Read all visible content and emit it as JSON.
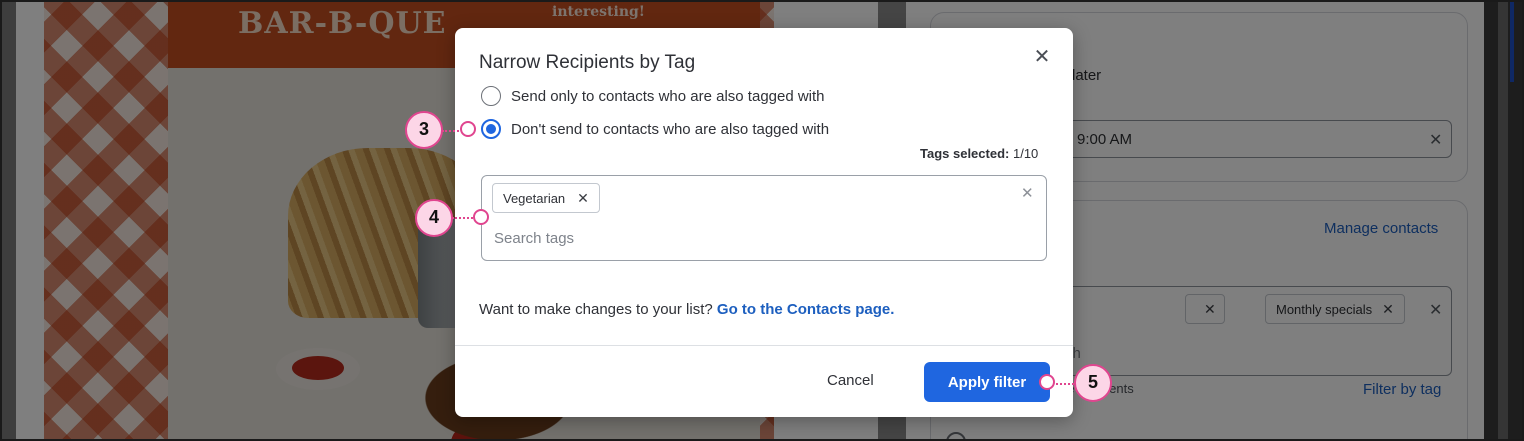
{
  "background": {
    "email": {
      "brand_title": "BAR-B-QUE",
      "header_subtext": "interesting!"
    },
    "settings": {
      "schedule_text": "later",
      "time_value": "9:00 AM",
      "manage_contacts_link": "Manage contacts",
      "chip_partial_label": "",
      "chip_monthly": "Monthly specials",
      "search_partial": "rch",
      "recipients_partial": "ue recipients",
      "filter_by_tag_link": "Filter by tag"
    }
  },
  "modal": {
    "title": "Narrow Recipients by Tag",
    "options": [
      {
        "label": "Send only to contacts who are also tagged with",
        "selected": false
      },
      {
        "label": "Don't send to contacts who are also tagged with",
        "selected": true
      }
    ],
    "tags_selected_label": "Tags selected:",
    "tags_selected_value": "1/10",
    "tags": [
      "Vegetarian"
    ],
    "search_placeholder": "Search tags",
    "list_note": "Want to make changes to your list?",
    "contacts_link": "Go to the Contacts page.",
    "cancel_label": "Cancel",
    "apply_label": "Apply filter",
    "accent_color": "#1f66e0"
  },
  "callouts": [
    "3",
    "4",
    "5"
  ],
  "icons": {
    "close": "close-icon",
    "tag_remove": "remove-tag-icon",
    "clear": "clear-icon"
  }
}
